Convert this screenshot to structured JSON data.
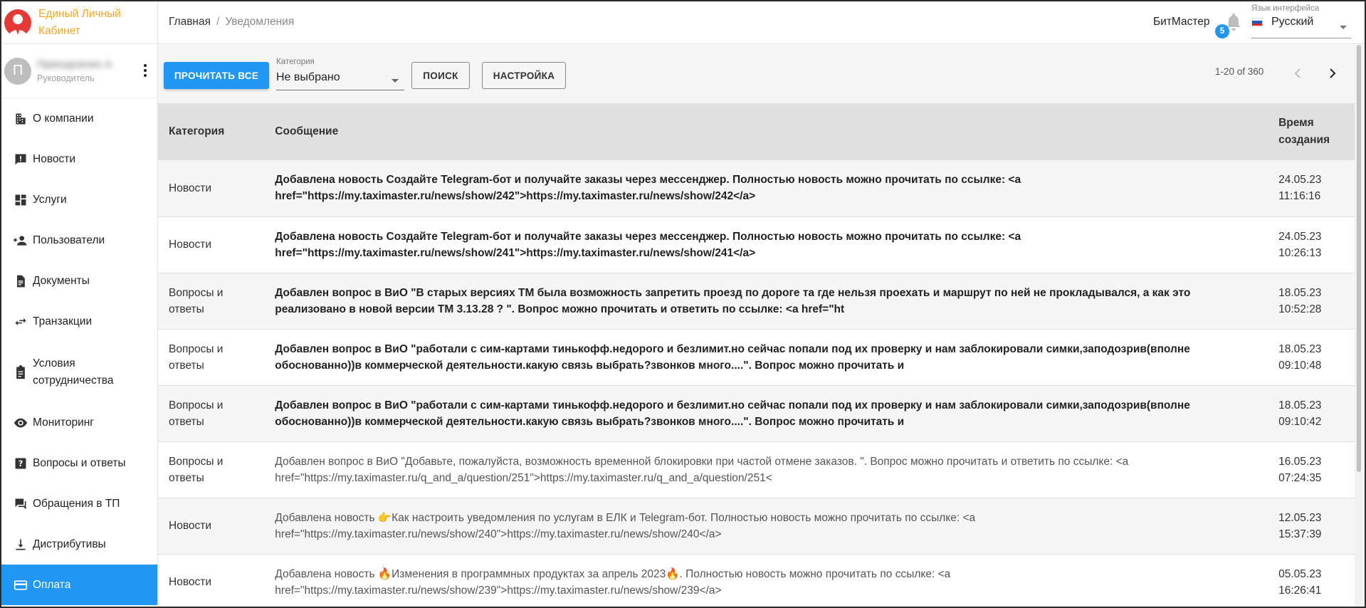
{
  "brand": {
    "title_line1": "Единый Личный",
    "title_line2": "Кабинет"
  },
  "user": {
    "avatar_letter": "П",
    "name": "Приходченко А",
    "role": "Руководитель"
  },
  "sidebar": {
    "items": [
      {
        "label": "О компании",
        "icon": "company-icon"
      },
      {
        "label": "Новости",
        "icon": "news-icon"
      },
      {
        "label": "Услуги",
        "icon": "services-icon"
      },
      {
        "label": "Пользователи",
        "icon": "users-icon"
      },
      {
        "label": "Документы",
        "icon": "documents-icon"
      },
      {
        "label": "Транзакции",
        "icon": "transactions-icon"
      },
      {
        "label": "Условия сотрудничества",
        "icon": "clipboard-icon"
      },
      {
        "label": "Мониторинг",
        "icon": "eye-icon"
      },
      {
        "label": "Вопросы и ответы",
        "icon": "question-icon"
      },
      {
        "label": "Обращения в ТП",
        "icon": "chat-icon"
      },
      {
        "label": "Дистрибутивы",
        "icon": "download-icon"
      },
      {
        "label": "Оплата",
        "icon": "credit-card-icon",
        "active": true
      }
    ]
  },
  "header": {
    "breadcrumb_home": "Главная",
    "breadcrumb_sep": "/",
    "breadcrumb_current": "Уведомления",
    "company": "БитМастер",
    "notifications_count": "5",
    "lang_label": "Язык интерфейса",
    "lang_value": "Русский"
  },
  "toolbar": {
    "read_all": "ПРОЧИТАТЬ ВСЕ",
    "category_label": "Категория",
    "category_value": "Не выбрано",
    "search": "ПОИСК",
    "settings": "НАСТРОЙКА",
    "pager": "1-20 of 360"
  },
  "table": {
    "headers": {
      "category": "Категория",
      "message": "Сообщение",
      "time": "Время создания"
    },
    "rows": [
      {
        "category": "Новости",
        "message": "Добавлена новость Создайте Telegram-бот и получайте заказы через мессенджер. Полностью новость можно прочитать по ссылке: <a href=\"https://my.taximaster.ru/news/show/242\">https://my.taximaster.ru/news/show/242</a>",
        "date": "24.05.23",
        "time": "11:16:16",
        "unread": true
      },
      {
        "category": "Новости",
        "message": "Добавлена новость Создайте Telegram-бот и получайте заказы через мессенджер. Полностью новость можно прочитать по ссылке: <a href=\"https://my.taximaster.ru/news/show/241\">https://my.taximaster.ru/news/show/241</a>",
        "date": "24.05.23",
        "time": "10:26:13",
        "unread": true
      },
      {
        "category": "Вопросы и ответы",
        "message": "Добавлен вопрос в ВиО \"В старых версиях ТМ была возможность запретить проезд по дороге та где нельзя проехать и маршрут по ней не прокладывался, а как это реализовано в новой версии ТМ 3.13.28 ?  \". Вопрос можно прочитать и ответить по ссылке: <a href=\"ht",
        "date": "18.05.23",
        "time": "10:52:28",
        "unread": true
      },
      {
        "category": "Вопросы и ответы",
        "message": "Добавлен вопрос в ВиО \"работали с сим-картами тинькофф.недорого и безлимит.но сейчас попали под их проверку и нам заблокировали симки,заподозрив(вполне обоснованно))в коммерческой деятельности.какую связь выбрать?звонков много....\". Вопрос можно прочитать и",
        "date": "18.05.23",
        "time": "09:10:48",
        "unread": true
      },
      {
        "category": "Вопросы и ответы",
        "message": "Добавлен вопрос в ВиО \"работали с сим-картами тинькофф.недорого и безлимит.но сейчас попали под их проверку и нам заблокировали симки,заподозрив(вполне обоснованно))в коммерческой деятельности.какую связь выбрать?звонков много....\". Вопрос можно прочитать и",
        "date": "18.05.23",
        "time": "09:10:42",
        "unread": true
      },
      {
        "category": "Вопросы и ответы",
        "message": "Добавлен вопрос в ВиО \"Добавьте, пожалуйста, возможность временной блокировки при частой отмене заказов. \". Вопрос можно прочитать и ответить по ссылке: <a href=\"https://my.taximaster.ru/q_and_a/question/251\">https://my.taximaster.ru/q_and_a/question/251<",
        "date": "16.05.23",
        "time": "07:24:35",
        "unread": false
      },
      {
        "category": "Новости",
        "message": "Добавлена новость 👉Как настроить уведомления по услугам в ЕЛК и Telegram-бот. Полностью новость можно прочитать по ссылке: <a href=\"https://my.taximaster.ru/news/show/240\">https://my.taximaster.ru/news/show/240</a>",
        "date": "12.05.23",
        "time": "15:37:39",
        "unread": false
      },
      {
        "category": "Новости",
        "message": "Добавлена новость 🔥Изменения в программных продуктах за апрель 2023🔥. Полностью новость можно прочитать по ссылке: <a href=\"https://my.taximaster.ru/news/show/239\">https://my.taximaster.ru/news/show/239</a>",
        "date": "05.05.23",
        "time": "16:26:41",
        "unread": false
      }
    ]
  },
  "colors": {
    "accent": "#2196f3",
    "brand_orange": "#f5a623",
    "logo_red": "#e53935"
  }
}
